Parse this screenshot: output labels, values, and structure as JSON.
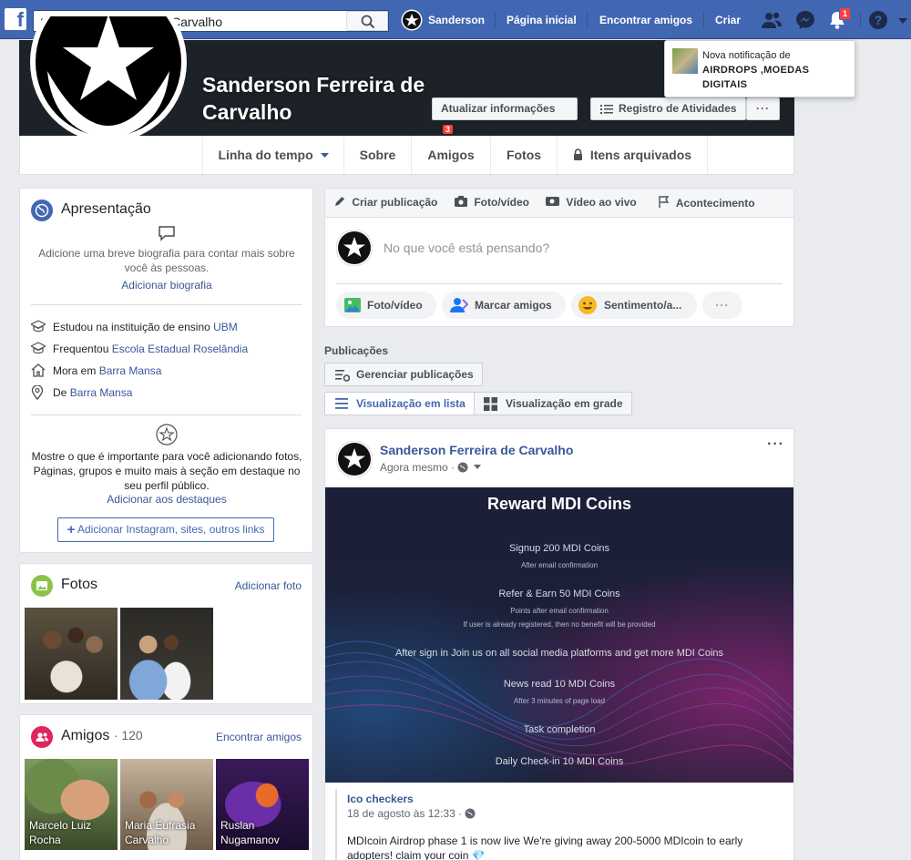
{
  "topbar": {
    "search_value": "Sanderson Ferreira de Carvalho",
    "profile_name": "Sanderson",
    "nav_home": "Página inicial",
    "nav_find_friends": "Encontrar amigos",
    "nav_create": "Criar",
    "notif_count": "1"
  },
  "notification": {
    "line1": "Nova notificação de",
    "line2": "AIRDROPS ,MOEDAS",
    "line3": "DIGITAIS"
  },
  "profile": {
    "name": "Sanderson Ferreira de Carvalho",
    "update_info_label": "Atualizar informações",
    "update_info_count": "3",
    "activity_log_label": "Registro de Atividades",
    "more_label": "···"
  },
  "tabs": [
    {
      "label": "Linha do tempo"
    },
    {
      "label": "Sobre"
    },
    {
      "label": "Amigos"
    },
    {
      "label": "Fotos"
    },
    {
      "label": "Itens arquivados"
    }
  ],
  "intro": {
    "title": "Apresentação",
    "bio_hint": "Adicione uma breve biografia para contar mais sobre você às pessoas.",
    "add_bio": "Adicionar biografia",
    "rows": [
      {
        "prefix": "Estudou na instituição de ensino ",
        "link": "UBM",
        "icon": "graduation-cap-icon"
      },
      {
        "prefix": "Frequentou ",
        "link": "Escola Estadual Roselândia",
        "icon": "graduation-cap-icon"
      },
      {
        "prefix": "Mora em ",
        "link": "Barra Mansa",
        "icon": "home-icon"
      },
      {
        "prefix": "De ",
        "link": "Barra Mansa",
        "icon": "location-pin-icon"
      }
    ],
    "featured_hint": "Mostre o que é importante para você adicionando fotos, Páginas, grupos e muito mais à seção em destaque no seu perfil público.",
    "add_featured": "Adicionar aos destaques",
    "add_links": "Adicionar Instagram, sites, outros links"
  },
  "photos": {
    "title": "Fotos",
    "add_photo": "Adicionar foto"
  },
  "friends": {
    "title": "Amigos",
    "count": "· 120",
    "find": "Encontrar amigos",
    "list": [
      {
        "name": "Marcelo Luiz Rocha"
      },
      {
        "name": "Maria Eufrasia Carvalho"
      },
      {
        "name": "Ruslan Nugamanov"
      }
    ]
  },
  "composer": {
    "tabs": [
      "Criar publicação",
      "Foto/vídeo",
      "Vídeo ao vivo",
      "Acontecimento"
    ],
    "placeholder": "No que você está pensando?",
    "pills": [
      "Foto/vídeo",
      "Marcar amigos",
      "Sentimento/a...",
      "···"
    ]
  },
  "posts_section": {
    "title": "Publicações",
    "manage": "Gerenciar publicações",
    "list_view": "Visualização em lista",
    "grid_view": "Visualização em grade"
  },
  "post": {
    "author": "Sanderson Ferreira de Carvalho",
    "time": "Agora mesmo ·",
    "more": "···",
    "image": {
      "title": "Reward MDI Coins",
      "lines": [
        {
          "text": "Signup 200 MDI Coins",
          "sub": "After email confirmation"
        },
        {
          "text": "Refer & Earn 50 MDI Coins",
          "sub": "Points after email confirmation",
          "sub2": "If user is already registered, then no benefit will be provided"
        },
        {
          "text": "After sign in Join us on all social media platforms and get more MDI Coins"
        },
        {
          "text": "News read 10 MDI Coins",
          "sub": "After 3 minutes of page load"
        },
        {
          "text": "Task completion"
        },
        {
          "text": "Daily Check-in 10 MDI Coins"
        }
      ]
    },
    "shared_author": "Ico checkers",
    "shared_time": "18 de agosto às 12:33 ·",
    "shared_text": "MDIcoin Airdrop phase 1 is now live We're giving away 200-5000 MDIcoin to early adopters! claim your coin 💎"
  },
  "colors": {
    "fb_blue": "#4267b2",
    "link": "#385898",
    "badge_red": "#fa3e3e",
    "cover_dark": "#1d2128"
  }
}
